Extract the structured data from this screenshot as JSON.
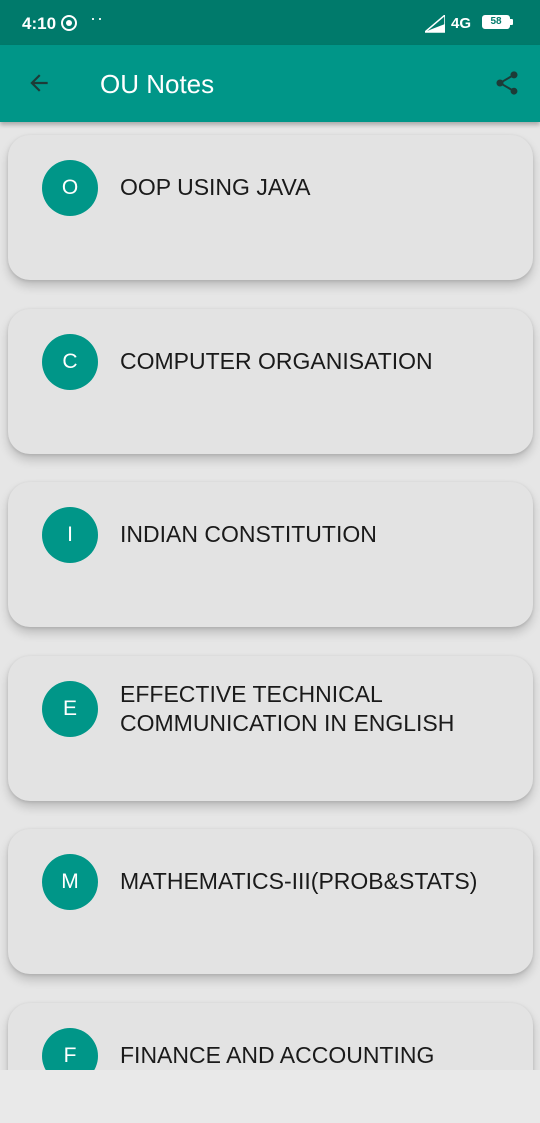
{
  "status_bar": {
    "time": "4:10",
    "dots": "··",
    "network": "4G",
    "battery": "58"
  },
  "app_bar": {
    "title": "OU Notes"
  },
  "subjects": [
    {
      "initial": "O",
      "title": "OOP USING JAVA"
    },
    {
      "initial": "C",
      "title": "COMPUTER ORGANISATION"
    },
    {
      "initial": "I",
      "title": "INDIAN CONSTITUTION"
    },
    {
      "initial": "E",
      "title": "EFFECTIVE TECHNICAL COMMUNICATION IN ENGLISH"
    },
    {
      "initial": "M",
      "title": "MATHEMATICS-III(PROB&STATS)"
    },
    {
      "initial": "F",
      "title": "FINANCE AND ACCOUNTING"
    }
  ],
  "colors": {
    "status_bar": "#007a6b",
    "app_bar": "#009688",
    "avatar": "#009688",
    "card": "#e3e3e3",
    "background": "#e6e6e6"
  },
  "icons": {
    "back": "arrow-left-icon",
    "share": "share-icon",
    "sync": "sync-icon",
    "signal": "signal-icon",
    "battery": "battery-icon"
  }
}
